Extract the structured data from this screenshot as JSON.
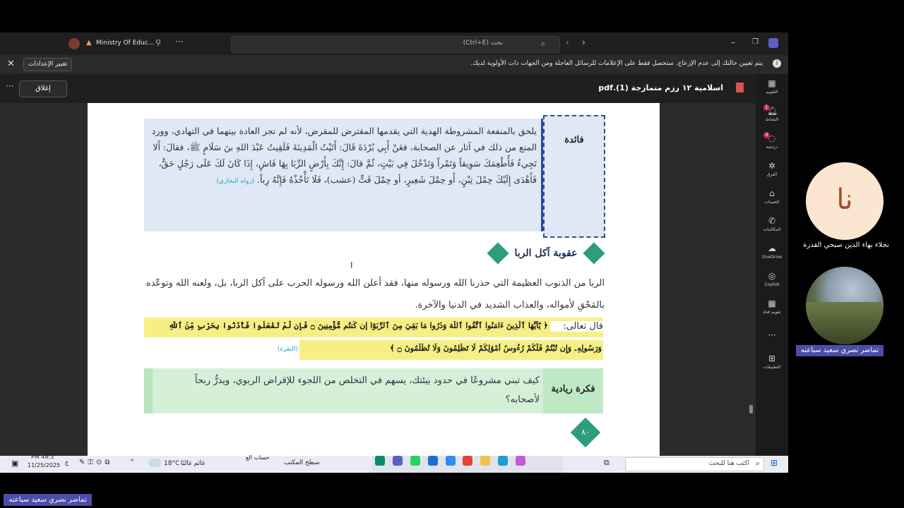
{
  "titlebar": {
    "org": "Ministry Of Educ...",
    "search_placeholder": "بحث (Ctrl+E)"
  },
  "notice": {
    "text": "يتم تعيين حالتك إلى عدم الإزعاج. ستحصل فقط على الإعلامات للرسائل العاجلة ومن الجهات ذات الأولوية لديك.",
    "settings_button": "تغيير الإعدادات"
  },
  "toolbar": {
    "close_button": "إغلاق",
    "filename": "اسلامية ١٢ رزم متمازجة (1).pdf"
  },
  "rail": [
    {
      "label": "التقويم",
      "icon": "calendar-icon"
    },
    {
      "label": "النشاط",
      "icon": "bell-icon",
      "badge": "1"
    },
    {
      "label": "دردشة",
      "icon": "chat-icon",
      "badge": "4"
    },
    {
      "label": "الفرق",
      "icon": "teams-icon"
    },
    {
      "label": "التعيينات",
      "icon": "assignments-icon"
    },
    {
      "label": "المكالمات",
      "icon": "phone-icon"
    },
    {
      "label": "OneDrive",
      "icon": "cloud-icon"
    },
    {
      "label": "Copilot",
      "icon": "copilot-icon"
    },
    {
      "label": "تقويم قناة",
      "icon": "channel-calendar-icon"
    },
    {
      "label": "التطبيقات",
      "icon": "apps-icon"
    }
  ],
  "document": {
    "faida_label": "فائدة",
    "faida_text": "يلحق بالمنفعة المشروطة الهدية التي يقدمها المقترض للمقرض، لأنه لم تجر العادة بينهما في التهادي، وورد المنع من ذلك في آثار عن الصحابة، فعَنْ أَبِي بُرْدَةَ قَالَ: أَتَيْتُ الْمَدِينَةَ فَلَقِيتُ عَبْدَ اللهِ بنَ سَلَامٍ ﷺ، فقالَ: أَلا تَجِيءُ فَأُطْعِمَكَ سَوِيقاً وَتَمْراً وَتَدْخُلَ فِي بَيْتٍ، ثُمَّ قالَ: إِنَّكَ بِأَرْضٍ الرِّبَا بِهَا فَاشٍ، إِذَا كَانَ لَكَ عَلَى رَجُلٍ حَقٌّ، فَأَهْدَى إِلَيْكَ حِمْلَ تِبْنٍ، أَو حِمْلَ شَعِيرٍ، أو حِمْلَ قَتٍّ (عشب)، فَلَا تَأْخُذْهُ فَإِنَّهُ رِباً.",
    "faida_source": "(رواه البخاري)",
    "section_title": "عقوبة آكل الربا",
    "paragraph": "الربا من الذنوب العظيمة التي حذرنا الله ورسوله منها، فقد أعلن الله ورسوله الحرب على آكل الربا، بل، ولعنه الله وتوعّده بالمَحْقِ لأمواله، والعذاب الشديد في الدنيا والآخرة.",
    "verse_intro": "قال تعالى:",
    "verse_line1": "﴿ يَٰٓأَيُّهَا ٱلَّذِينَ ءَامَنُوا ٱتَّقُوا ٱللَّهَ وَذَرُوا مَا بَقِيَ مِنَ ٱلرِّبَوٰٓا إِن كُنتُم مُّؤْمِنِينَ ۝ فَإِن لَّمْ تَفْعَلُوا فَأْذَنُوا بِحَرْبٍ مِّنَ ٱللَّهِ",
    "verse_line2": "وَرَسُولِهِۦ وَإِن تُبْتُمْ فَلَكُمْ رُءُوسُ أَمْوَٰلِكُمْ لَا تَظْلِمُونَ وَلَا تُظْلَمُونَ ۝ ﴾",
    "verse_source": "(البقرة)",
    "idea_label": "فكرة ريادية",
    "idea_text": "كيف تبني مشروعًا في حدود بيئتك، يسهم في التخلص من اللجوء للإقراض الربوي، ويدرُّ ربحاً لأصحابه؟",
    "page_number": "٨٠"
  },
  "taskbar": {
    "search": "اكتب هنا للبحث",
    "weather": "غائم غالبًا",
    "temp": "18°C",
    "time": "PM 48:3",
    "date": "11/25/2025",
    "lang": "ع",
    "desktop": "سطح المكتب",
    "account": "حساب الع"
  },
  "participants": {
    "top_name": "نجلاء بهاء الدين صبحي القدرة",
    "top_initials": "نا",
    "video_name": "تماضر نصري سعيد سباعنه",
    "bottom_label": "تماضر نصري سعيد سباعنه"
  },
  "colors": {
    "avatar_bg": "#fbe6d2",
    "avatar_text": "#a0522d",
    "name_tag": "#4b4ea8",
    "highlight": "#f6f084",
    "faida_bg": "#dfe8f4",
    "idea_bg": "#d6f0d8"
  }
}
